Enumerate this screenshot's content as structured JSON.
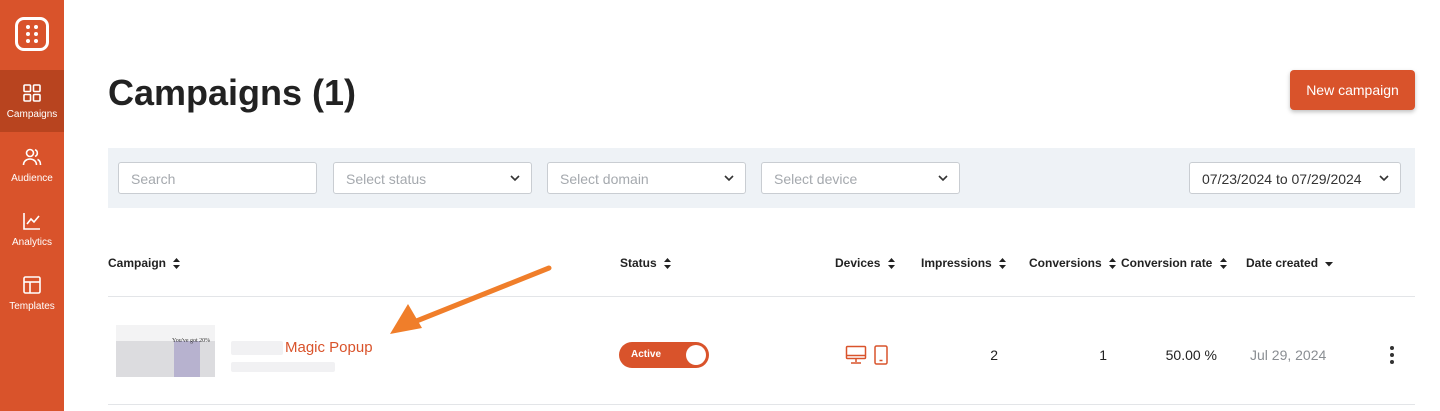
{
  "sidebar": {
    "items": [
      {
        "label": "Campaigns",
        "icon": "grid-icon",
        "active": true
      },
      {
        "label": "Audience",
        "icon": "users-icon",
        "active": false
      },
      {
        "label": "Analytics",
        "icon": "chart-line-icon",
        "active": false
      },
      {
        "label": "Templates",
        "icon": "layout-icon",
        "active": false
      }
    ]
  },
  "header": {
    "title": "Campaigns (1)",
    "new_button_label": "New campaign"
  },
  "filters": {
    "search_placeholder": "Search",
    "status_placeholder": "Select status",
    "domain_placeholder": "Select domain",
    "device_placeholder": "Select device",
    "date_range": "07/23/2024 to 07/29/2024"
  },
  "table": {
    "columns": [
      "Campaign",
      "Status",
      "Devices",
      "Impressions",
      "Conversions",
      "Conversion rate",
      "Date created"
    ],
    "rows": [
      {
        "campaign": "Magic Popup",
        "thumbnail_text": "You've got 20%",
        "status": "Active",
        "devices": [
          "desktop-icon",
          "mobile-icon"
        ],
        "impressions": "2",
        "conversions": "1",
        "conversion_rate": "50.00 %",
        "date_created": "Jul 29, 2024"
      }
    ]
  },
  "colors": {
    "brand": "#d9532b",
    "sidebar_active": "#b8441f",
    "filter_bar": "#eef2f6",
    "arrow": "#f07e2a"
  }
}
